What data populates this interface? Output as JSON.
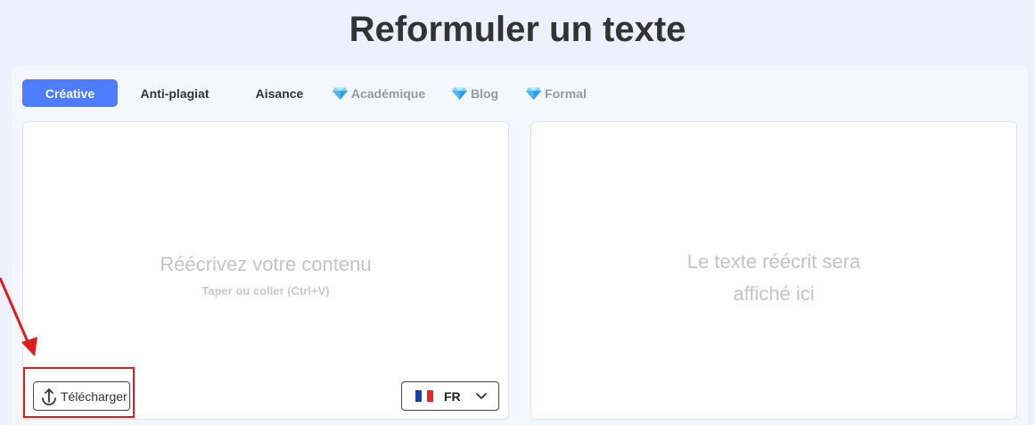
{
  "header": {
    "title": "Reformuler un texte"
  },
  "tabs": [
    {
      "label": "Créative",
      "active": true,
      "premium": false
    },
    {
      "label": "Anti-plagiat",
      "active": false,
      "premium": false
    },
    {
      "label": "Aisance",
      "active": false,
      "premium": false
    },
    {
      "label": "Académique",
      "active": false,
      "premium": true,
      "icon": "diamond-icon"
    },
    {
      "label": "Blog",
      "active": false,
      "premium": true,
      "icon": "diamond-icon"
    },
    {
      "label": "Formal",
      "active": false,
      "premium": true,
      "icon": "diamond-icon"
    }
  ],
  "input_box": {
    "placeholder_title": "Réécrivez votre contenu",
    "placeholder_hint": "Taper ou coller (Ctrl+V)",
    "upload_label": "Télécharger",
    "upload_icon": "upload-icon",
    "language": {
      "code": "FR",
      "flag": "france-flag-icon"
    }
  },
  "output_box": {
    "placeholder_line1": "Le texte réécrit sera",
    "placeholder_line2": "affiché ici"
  },
  "annotation": {
    "highlight_color": "#e01b1b",
    "arrow_color": "#e01b1b"
  },
  "colors": {
    "accent": "#4d7cfe",
    "background": "#ecf1fd",
    "title": "#333333"
  }
}
